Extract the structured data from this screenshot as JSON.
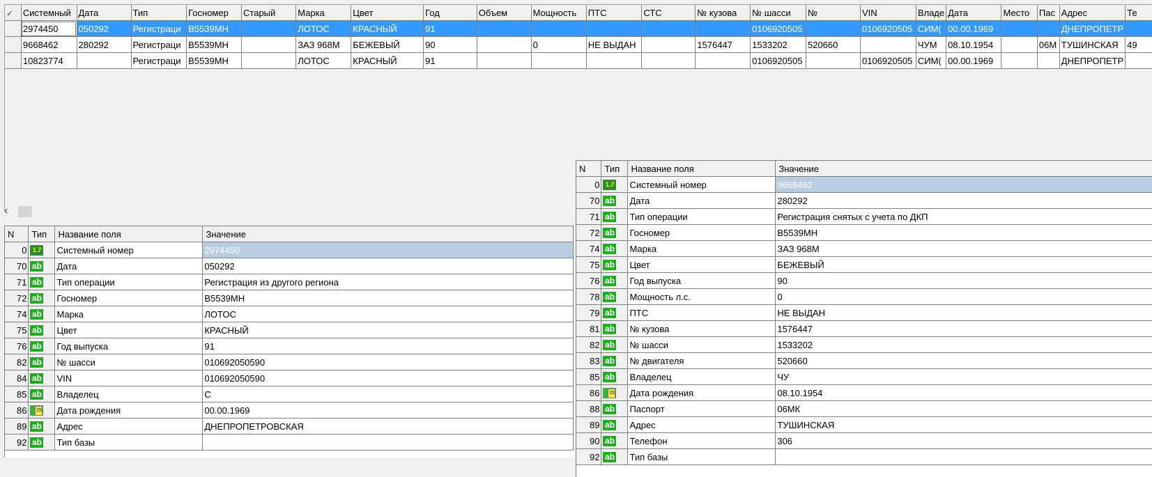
{
  "top_grid": {
    "columns": [
      "Системный",
      "Дата",
      "Тип",
      "Госномер",
      "Старый",
      "Марка",
      "Цвет",
      "Год",
      "Объем",
      "Мощность",
      "ПТС",
      "СТС",
      "№ кузова",
      "№ шасси",
      "№",
      "VIN",
      "Владе",
      "Дата",
      "Место",
      "Пас",
      "Адрес",
      "Те"
    ],
    "rows": [
      [
        "2974450",
        "050292",
        "Регистраци",
        "В5539МН",
        "",
        "ЛОТОС",
        "КРАСНЫЙ",
        "91",
        "",
        "",
        "",
        "",
        "",
        "0106920505",
        "",
        "0106920505",
        "СИМ(",
        "00.00.1969",
        "",
        "",
        "ДНЕПРОПЕТР",
        ""
      ],
      [
        "9668462",
        "280292",
        "Регистраци",
        "В5539МН",
        "",
        "ЗАЗ 968М",
        "БЕЖЕВЫЙ",
        "90",
        "",
        "0",
        "НЕ ВЫДАН",
        "",
        "1576447",
        "1533202",
        "520660",
        "",
        "ЧУМ",
        "08.10.1954",
        "",
        "06М",
        "ТУШИНСКАЯ",
        "49"
      ],
      [
        "10823774",
        "",
        "Регистраци",
        "В5539МН",
        "",
        "ЛОТОС",
        "КРАСНЫЙ",
        "91",
        "",
        "",
        "",
        "",
        "",
        "0106920505",
        "",
        "0106920505",
        "СИМ(",
        "00.00.1969",
        "",
        "",
        "ДНЕПРОПЕТР",
        ""
      ]
    ]
  },
  "prop_headers": {
    "n": "N",
    "type": "Тип",
    "name": "Название поля",
    "value": "Значение"
  },
  "prop_left": [
    {
      "n": "0",
      "icon": "num",
      "name": "Системный номер",
      "value": "2974450"
    },
    {
      "n": "70",
      "icon": "ab",
      "name": "Дата",
      "value": "050292"
    },
    {
      "n": "71",
      "icon": "ab",
      "name": "Тип операции",
      "value": "Регистрация из другого региона"
    },
    {
      "n": "72",
      "icon": "ab",
      "name": "Госномер",
      "value": "В5539МН"
    },
    {
      "n": "74",
      "icon": "ab",
      "name": "Марка",
      "value": "ЛОТОС"
    },
    {
      "n": "75",
      "icon": "ab",
      "name": "Цвет",
      "value": "КРАСНЫЙ"
    },
    {
      "n": "76",
      "icon": "ab",
      "name": "Год выпуска",
      "value": "91"
    },
    {
      "n": "82",
      "icon": "ab",
      "name": "№ шасси",
      "value": "010692050590"
    },
    {
      "n": "84",
      "icon": "ab",
      "name": "VIN",
      "value": "010692050590"
    },
    {
      "n": "85",
      "icon": "ab",
      "name": "Владелец",
      "value": "С"
    },
    {
      "n": "86",
      "icon": "date",
      "name": "Дата рождения",
      "value": "00.00.1969"
    },
    {
      "n": "89",
      "icon": "ab",
      "name": "Адрес",
      "value": "ДНЕПРОПЕТРОВСКАЯ"
    },
    {
      "n": "92",
      "icon": "ab",
      "name": "Тип базы",
      "value": ""
    }
  ],
  "prop_right": [
    {
      "n": "0",
      "icon": "num",
      "name": "Системный номер",
      "value": "9668462"
    },
    {
      "n": "70",
      "icon": "ab",
      "name": "Дата",
      "value": "280292"
    },
    {
      "n": "71",
      "icon": "ab",
      "name": "Тип операции",
      "value": "Регистрация снятых с учета по ДКП"
    },
    {
      "n": "72",
      "icon": "ab",
      "name": "Госномер",
      "value": "В5539МН"
    },
    {
      "n": "74",
      "icon": "ab",
      "name": "Марка",
      "value": "ЗАЗ 968М"
    },
    {
      "n": "75",
      "icon": "ab",
      "name": "Цвет",
      "value": "БЕЖЕВЫЙ"
    },
    {
      "n": "76",
      "icon": "ab",
      "name": "Год выпуска",
      "value": "90"
    },
    {
      "n": "78",
      "icon": "ab",
      "name": "Мощность л.с.",
      "value": "0"
    },
    {
      "n": "79",
      "icon": "ab",
      "name": "ПТС",
      "value": "НЕ ВЫДАН"
    },
    {
      "n": "81",
      "icon": "ab",
      "name": "№ кузова",
      "value": "1576447"
    },
    {
      "n": "82",
      "icon": "ab",
      "name": "№ шасси",
      "value": "1533202"
    },
    {
      "n": "83",
      "icon": "ab",
      "name": "№ двигателя",
      "value": "520660"
    },
    {
      "n": "85",
      "icon": "ab",
      "name": "Владелец",
      "value": "ЧУ"
    },
    {
      "n": "86",
      "icon": "date",
      "name": "Дата рождения",
      "value": "08.10.1954"
    },
    {
      "n": "88",
      "icon": "ab",
      "name": "Паспорт",
      "value": "06МК"
    },
    {
      "n": "89",
      "icon": "ab",
      "name": "Адрес",
      "value": "ТУШИНСКАЯ"
    },
    {
      "n": "90",
      "icon": "ab",
      "name": "Телефон",
      "value": "306"
    },
    {
      "n": "92",
      "icon": "ab",
      "name": "Тип базы",
      "value": ""
    }
  ],
  "icons": {
    "ab_label": "ab",
    "num_label": "1.7",
    "date_label": "15"
  }
}
